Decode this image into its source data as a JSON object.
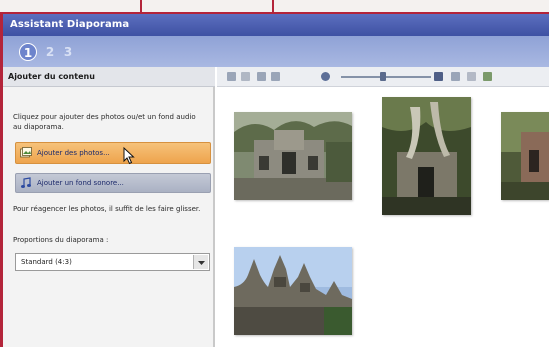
{
  "window": {
    "title": "Assistant Diaporama"
  },
  "steps": [
    "1",
    "2",
    "3"
  ],
  "left_panel": {
    "heading": "Ajouter du contenu",
    "intro": "Cliquez pour ajouter des photos ou/et un fond audio au diaporama.",
    "add_photos_label": "Ajouter des photos...",
    "add_audio_label": "Ajouter un fond sonore...",
    "reorder_hint": "Pour réagencer les photos, il suffit de les faire glisser.",
    "proportions_label": "Proportions du diaporama :",
    "proportions_value": "Standard (4:3)"
  },
  "toolbar": {
    "icons": [
      "select-all-icon",
      "delete-icon",
      "rotate-left-icon",
      "rotate-right-icon",
      "zoom-out-icon",
      "zoom-in-icon",
      "view-icon",
      "text-icon",
      "effects-icon"
    ],
    "zoom_level": 0.45
  },
  "photos": [
    {
      "name": "temple-ruins-photo",
      "caption": ""
    },
    {
      "name": "tree-temple-photo",
      "caption": ""
    },
    {
      "name": "temple-partial-photo",
      "caption": ""
    },
    {
      "name": "bayon-towers-photo",
      "caption": ""
    }
  ]
}
